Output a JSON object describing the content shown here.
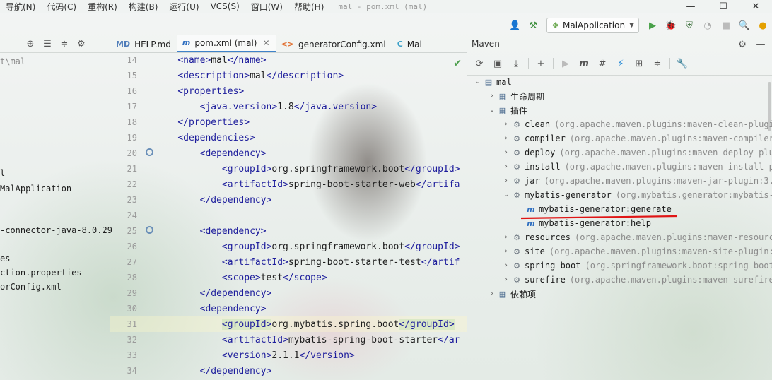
{
  "menubar": {
    "items": [
      "导航(N)",
      "代码(C)",
      "重构(R)",
      "构建(B)",
      "运行(U)",
      "VCS(S)",
      "窗口(W)",
      "帮助(H)"
    ],
    "window_title": "mal - pom.xml (mal)",
    "window_controls": [
      "—",
      "☐",
      "✕"
    ]
  },
  "toolbar": {
    "run_config": "MalApplication"
  },
  "project": {
    "lines": [
      {
        "text": "t\\mal",
        "dim": true
      },
      {
        "text": "l",
        "dim": false
      },
      {
        "text": "MalApplication",
        "dim": false
      },
      {
        "text": "-connector-java-8.0.29",
        "dim": false
      },
      {
        "text": "es",
        "dim": false
      },
      {
        "text": "ction.properties",
        "dim": false
      },
      {
        "text": "orConfig.xml",
        "dim": false
      }
    ]
  },
  "editor": {
    "tabs": [
      {
        "label": "HELP.md",
        "icon": "markdown-file-icon",
        "badge": "MD"
      },
      {
        "label": "pom.xml (mal)",
        "icon": "maven-file-icon",
        "badge": "m",
        "active": true
      },
      {
        "label": "generatorConfig.xml",
        "icon": "xml-file-icon",
        "badge": "<>"
      },
      {
        "label": "Mal",
        "icon": "class-file-icon",
        "badge": "C"
      }
    ],
    "lines": [
      {
        "n": "14",
        "indent": "    ",
        "pre": "<name>",
        "mid": "mal",
        "post": "</name>"
      },
      {
        "n": "15",
        "indent": "    ",
        "pre": "<description>",
        "mid": "mal",
        "post": "</description>"
      },
      {
        "n": "16",
        "indent": "    ",
        "pre": "<properties>",
        "mid": "",
        "post": ""
      },
      {
        "n": "17",
        "indent": "        ",
        "pre": "<java.version>",
        "mid": "1.8",
        "post": "</java.version>"
      },
      {
        "n": "18",
        "indent": "    ",
        "pre": "</properties>",
        "mid": "",
        "post": ""
      },
      {
        "n": "19",
        "indent": "    ",
        "pre": "<dependencies>",
        "mid": "",
        "post": ""
      },
      {
        "n": "20",
        "indent": "        ",
        "pre": "<dependency>",
        "mid": "",
        "post": ""
      },
      {
        "n": "21",
        "indent": "            ",
        "pre": "<groupId>",
        "mid": "org.springframework.boot",
        "post": "</groupId>"
      },
      {
        "n": "22",
        "indent": "            ",
        "pre": "<artifactId>",
        "mid": "spring-boot-starter-web",
        "post": "</artifa"
      },
      {
        "n": "23",
        "indent": "        ",
        "pre": "</dependency>",
        "mid": "",
        "post": ""
      },
      {
        "n": "24",
        "indent": "",
        "pre": "",
        "mid": "",
        "post": ""
      },
      {
        "n": "25",
        "indent": "        ",
        "pre": "<dependency>",
        "mid": "",
        "post": ""
      },
      {
        "n": "26",
        "indent": "            ",
        "pre": "<groupId>",
        "mid": "org.springframework.boot",
        "post": "</groupId>"
      },
      {
        "n": "27",
        "indent": "            ",
        "pre": "<artifactId>",
        "mid": "spring-boot-starter-test",
        "post": "</artif"
      },
      {
        "n": "28",
        "indent": "            ",
        "pre": "<scope>",
        "mid": "test",
        "post": "</scope>"
      },
      {
        "n": "29",
        "indent": "        ",
        "pre": "</dependency>",
        "mid": "",
        "post": ""
      },
      {
        "n": "30",
        "indent": "        ",
        "pre": "<dependency>",
        "mid": "",
        "post": ""
      },
      {
        "n": "31",
        "indent": "            ",
        "pre": "<groupId>",
        "mid": "org.mybatis.spring.boot",
        "post": "</groupId>",
        "highlight": true
      },
      {
        "n": "32",
        "indent": "            ",
        "pre": "<artifactId>",
        "mid": "mybatis-spring-boot-starter",
        "post": "</ar"
      },
      {
        "n": "33",
        "indent": "            ",
        "pre": "<version>",
        "mid": "2.1.1",
        "post": "</version>"
      },
      {
        "n": "34",
        "indent": "        ",
        "pre": "</dependency>",
        "mid": "",
        "post": ""
      }
    ],
    "gutter_marks": {
      "20": "run-gutter-icon",
      "25": "run-gutter-icon"
    }
  },
  "maven": {
    "title": "Maven",
    "tree": [
      {
        "depth": 0,
        "arrow": "⌄",
        "icon": "maven-project-icon",
        "name": "mal",
        "coord": ""
      },
      {
        "depth": 1,
        "arrow": "›",
        "icon": "folder-icon",
        "name": "生命周期",
        "coord": "",
        "cjk": true
      },
      {
        "depth": 1,
        "arrow": "⌄",
        "icon": "folder-icon",
        "name": "插件",
        "coord": "",
        "cjk": true
      },
      {
        "depth": 2,
        "arrow": "›",
        "icon": "plugin-icon",
        "name": "clean",
        "coord": "(org.apache.maven.plugins:maven-clean-plugir"
      },
      {
        "depth": 2,
        "arrow": "›",
        "icon": "plugin-icon",
        "name": "compiler",
        "coord": "(org.apache.maven.plugins:maven-compiler-"
      },
      {
        "depth": 2,
        "arrow": "›",
        "icon": "plugin-icon",
        "name": "deploy",
        "coord": "(org.apache.maven.plugins:maven-deploy-plug"
      },
      {
        "depth": 2,
        "arrow": "›",
        "icon": "plugin-icon",
        "name": "install",
        "coord": "(org.apache.maven.plugins:maven-install-pl"
      },
      {
        "depth": 2,
        "arrow": "›",
        "icon": "plugin-icon",
        "name": "jar",
        "coord": "(org.apache.maven.plugins:maven-jar-plugin:3.2"
      },
      {
        "depth": 2,
        "arrow": "⌄",
        "icon": "plugin-icon",
        "name": "mybatis-generator",
        "coord": "(org.mybatis.generator:mybatis-g"
      },
      {
        "depth": 3,
        "arrow": "",
        "icon": "goal-icon",
        "name": "mybatis-generator:generate",
        "coord": ""
      },
      {
        "depth": 3,
        "arrow": "",
        "icon": "goal-icon",
        "name": "mybatis-generator:help",
        "coord": ""
      },
      {
        "depth": 2,
        "arrow": "›",
        "icon": "plugin-icon",
        "name": "resources",
        "coord": "(org.apache.maven.plugins:maven-resource"
      },
      {
        "depth": 2,
        "arrow": "›",
        "icon": "plugin-icon",
        "name": "site",
        "coord": "(org.apache.maven.plugins:maven-site-plugin:3"
      },
      {
        "depth": 2,
        "arrow": "›",
        "icon": "plugin-icon",
        "name": "spring-boot",
        "coord": "(org.springframework.boot:spring-boot-"
      },
      {
        "depth": 2,
        "arrow": "›",
        "icon": "plugin-icon",
        "name": "surefire",
        "coord": "(org.apache.maven.plugins:maven-surefire-"
      },
      {
        "depth": 1,
        "arrow": "›",
        "icon": "folder-icon",
        "name": "依赖项",
        "coord": "",
        "cjk": true
      }
    ]
  },
  "colors": {
    "annotation_underline": "#e01515",
    "run_green": "#4aa14a",
    "tag_blue": "#1d1d9c",
    "active_tab": "#4083c9"
  }
}
